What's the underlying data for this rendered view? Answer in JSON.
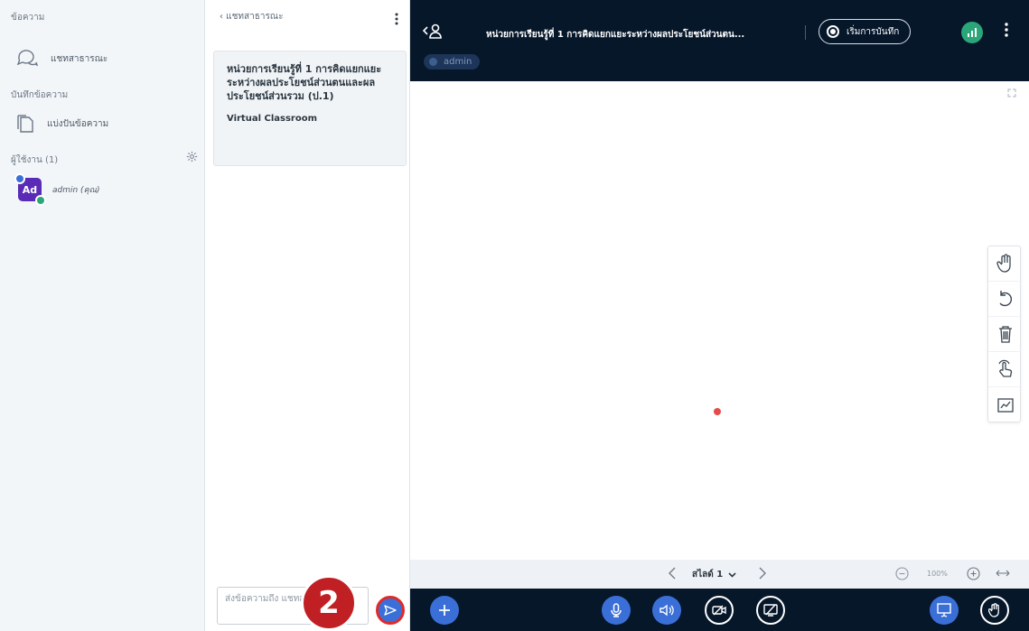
{
  "sidebar": {
    "messages_title": "ข้อความ",
    "public_chat_label": "แชทสาธารณะ",
    "notes_title": "บันทึกข้อความ",
    "shared_notes_label": "แบ่งปันข้อความ",
    "users_title": "ผู้ใช้งาน (1)",
    "users": [
      {
        "initials": "Ad",
        "name": "admin (คุณ)"
      }
    ]
  },
  "chat": {
    "header": "‹  แชทสาธารณะ",
    "welcome_title": "หน่วยการเรียนรู้ที่ 1 การคิดแยกแยะระหว่างผลประโยชน์ส่วนตนและผลประโยชน์ส่วนรวม (ป.1)",
    "welcome_subtitle": "Virtual Classroom",
    "input_placeholder": "ส่งข้อความถึง แชทสาธารณะ",
    "step_badge": "2"
  },
  "topbar": {
    "meeting_title": "หน่วยการเรียนรู้ที่ 1 การคิดแยกแยะระหว่างผลประโยชน์ส่วนตน...",
    "record_label": "เริ่มการบันทึก",
    "presenter_tag": "admin"
  },
  "slide_nav": {
    "slide_label": "สไลด์ 1",
    "zoom": "100%"
  },
  "colors": {
    "dark_bar": "#06172a",
    "accent_blue": "#3b6fd8",
    "status_green": "#2ba678",
    "badge_red": "#c02024",
    "avatar_purple": "#5a2bb6"
  }
}
